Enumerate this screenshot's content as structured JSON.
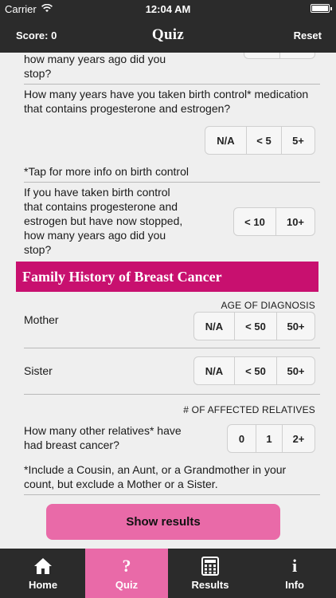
{
  "status": {
    "carrier": "Carrier",
    "time": "12:04 AM"
  },
  "nav": {
    "score": "Score: 0",
    "title": "Quiz",
    "reset": "Reset"
  },
  "questions": {
    "stopped_1_line1": "how many years ago did you",
    "stopped_1_line2": "stop?",
    "bc_years_line1": "How many years have you taken birth control* medication",
    "bc_years_line2": "that contains progesterone and estrogen?",
    "bc_years_options": [
      "N/A",
      "< 5",
      "5+"
    ],
    "bc_note": "*Tap for more info on birth control",
    "bc_stopped_line1": "If you have taken birth control",
    "bc_stopped_line2": "that contains progesterone and",
    "bc_stopped_line3": "estrogen but have now stopped,",
    "bc_stopped_line4": "how many years ago did you",
    "bc_stopped_line5": "stop?",
    "bc_stopped_options": [
      "< 10",
      "10+"
    ]
  },
  "family": {
    "section_title": "Family History of Breast Cancer",
    "age_caption": "AGE OF DIAGNOSIS",
    "mother_label": "Mother",
    "mother_options": [
      "N/A",
      "< 50",
      "50+"
    ],
    "sister_label": "Sister",
    "sister_options": [
      "N/A",
      "< 50",
      "50+"
    ],
    "relatives_caption": "# OF AFFECTED RELATIVES",
    "relatives_line1": "How many other relatives* have",
    "relatives_line2": "had breast cancer?",
    "relatives_options": [
      "0",
      "1",
      "2+"
    ],
    "relatives_note_line1": "*Include a Cousin, an Aunt, or a Grandmother in your",
    "relatives_note_line2": "count, but exclude a Mother or a Sister."
  },
  "show_results": "Show results",
  "tabs": [
    {
      "label": "Home",
      "icon": "home-icon"
    },
    {
      "label": "Quiz",
      "icon": "question-icon",
      "active": true
    },
    {
      "label": "Results",
      "icon": "calculator-icon"
    },
    {
      "label": "Info",
      "icon": "info-icon"
    }
  ],
  "colors": {
    "bar": "#2b2b2b",
    "accent": "#c8106f",
    "button": "#e96aa8",
    "background": "#efefef"
  }
}
